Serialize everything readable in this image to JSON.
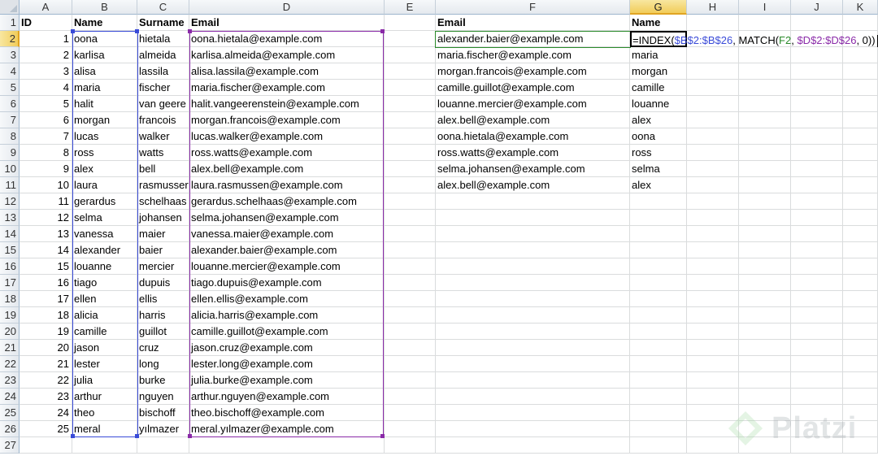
{
  "columns": [
    "A",
    "B",
    "C",
    "D",
    "E",
    "F",
    "G",
    "H",
    "I",
    "J",
    "K"
  ],
  "active_column": "G",
  "active_row": 2,
  "row_numbers": [
    1,
    2,
    3,
    4,
    5,
    6,
    7,
    8,
    9,
    10,
    11,
    12,
    13,
    14,
    15,
    16,
    17,
    18,
    19,
    20,
    21,
    22,
    23,
    24,
    25,
    26,
    27
  ],
  "headers": {
    "id": "ID",
    "name": "Name",
    "surname": "Surname",
    "email": "Email",
    "lookup_email": "Email",
    "lookup_name": "Name"
  },
  "records": [
    {
      "id": 1,
      "name": "oona",
      "surname": "hietala",
      "email": "oona.hietala@example.com"
    },
    {
      "id": 2,
      "name": "karlisa",
      "surname": "almeida",
      "email": "karlisa.almeida@example.com"
    },
    {
      "id": 3,
      "name": "alisa",
      "surname": "lassila",
      "email": "alisa.lassila@example.com"
    },
    {
      "id": 4,
      "name": "maria",
      "surname": "fischer",
      "email": "maria.fischer@example.com"
    },
    {
      "id": 5,
      "name": "halit",
      "surname": "van geere",
      "email": "halit.vangeerenstein@example.com"
    },
    {
      "id": 6,
      "name": "morgan",
      "surname": "francois",
      "email": "morgan.francois@example.com"
    },
    {
      "id": 7,
      "name": "lucas",
      "surname": "walker",
      "email": "lucas.walker@example.com"
    },
    {
      "id": 8,
      "name": "ross",
      "surname": "watts",
      "email": "ross.watts@example.com"
    },
    {
      "id": 9,
      "name": "alex",
      "surname": "bell",
      "email": "alex.bell@example.com"
    },
    {
      "id": 10,
      "name": "laura",
      "surname": "rasmusser",
      "email": "laura.rasmussen@example.com"
    },
    {
      "id": 11,
      "name": "gerardus",
      "surname": "schelhaas",
      "email": "gerardus.schelhaas@example.com"
    },
    {
      "id": 12,
      "name": "selma",
      "surname": "johansen",
      "email": "selma.johansen@example.com"
    },
    {
      "id": 13,
      "name": "vanessa",
      "surname": "maier",
      "email": "vanessa.maier@example.com"
    },
    {
      "id": 14,
      "name": "alexander",
      "surname": "baier",
      "email": "alexander.baier@example.com"
    },
    {
      "id": 15,
      "name": "louanne",
      "surname": "mercier",
      "email": "louanne.mercier@example.com"
    },
    {
      "id": 16,
      "name": "tiago",
      "surname": "dupuis",
      "email": "tiago.dupuis@example.com"
    },
    {
      "id": 17,
      "name": "ellen",
      "surname": "ellis",
      "email": "ellen.ellis@example.com"
    },
    {
      "id": 18,
      "name": "alicia",
      "surname": "harris",
      "email": "alicia.harris@example.com"
    },
    {
      "id": 19,
      "name": "camille",
      "surname": "guillot",
      "email": "camille.guillot@example.com"
    },
    {
      "id": 20,
      "name": "jason",
      "surname": "cruz",
      "email": "jason.cruz@example.com"
    },
    {
      "id": 21,
      "name": "lester",
      "surname": "long",
      "email": "lester.long@example.com"
    },
    {
      "id": 22,
      "name": "julia",
      "surname": "burke",
      "email": "julia.burke@example.com"
    },
    {
      "id": 23,
      "name": "arthur",
      "surname": "nguyen",
      "email": "arthur.nguyen@example.com"
    },
    {
      "id": 24,
      "name": "theo",
      "surname": "bischoff",
      "email": "theo.bischoff@example.com"
    },
    {
      "id": 25,
      "name": "meral",
      "surname": "yılmazer",
      "email": "meral.yılmazer@example.com"
    }
  ],
  "lookup": [
    {
      "email": "alexander.baier@example.com",
      "name": null
    },
    {
      "email": "maria.fischer@example.com",
      "name": "maria"
    },
    {
      "email": "morgan.francois@example.com",
      "name": "morgan"
    },
    {
      "email": "camille.guillot@example.com",
      "name": "camille"
    },
    {
      "email": "louanne.mercier@example.com",
      "name": "louanne"
    },
    {
      "email": "alex.bell@example.com",
      "name": "alex"
    },
    {
      "email": "oona.hietala@example.com",
      "name": "oona"
    },
    {
      "email": "ross.watts@example.com",
      "name": "ross"
    },
    {
      "email": "selma.johansen@example.com",
      "name": "selma"
    },
    {
      "email": "alex.bell@example.com",
      "name": "alex"
    }
  ],
  "formula": {
    "p1": "=INDEX(",
    "ref1": "$B$2:$B$26",
    "p2": ", MATCH(",
    "ref2": "F2",
    "p3": ", ",
    "ref3": "$D$2:$D$26",
    "p4": ", 0))"
  },
  "watermark": {
    "text": "Platzi"
  },
  "colors": {
    "ref_b": "#3a4bd8",
    "ref_f": "#2a8a2a",
    "ref_d": "#8a2aa8",
    "active_header": "#f1cc5a",
    "grid": "#dadcdd"
  }
}
